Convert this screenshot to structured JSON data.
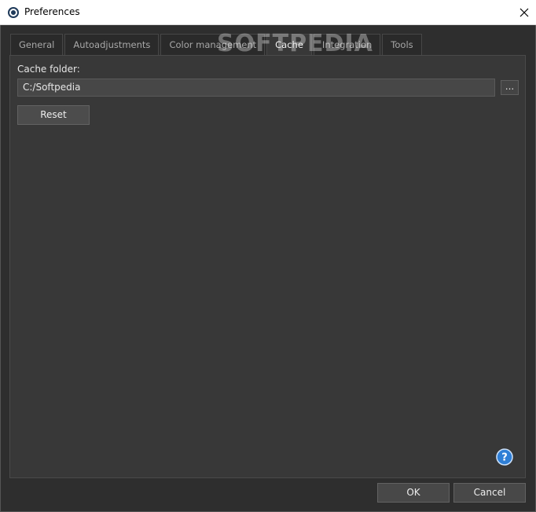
{
  "window": {
    "title": "Preferences"
  },
  "tabs": [
    {
      "label": "General"
    },
    {
      "label": "Autoadjustments"
    },
    {
      "label": "Color management"
    },
    {
      "label": "Cache",
      "active": true
    },
    {
      "label": "Integration"
    },
    {
      "label": "Tools"
    }
  ],
  "cache": {
    "folder_label": "Cache folder:",
    "folder_value": "C:/Softpedia",
    "browse_label": "...",
    "reset_label": "Reset"
  },
  "footer": {
    "ok_label": "OK",
    "cancel_label": "Cancel"
  },
  "watermark": "SOFTPEDIA",
  "colors": {
    "background": "#2e2e2e",
    "panel": "#383838",
    "help_blue": "#2f7fd6"
  },
  "icons": {
    "app": "app-logo-icon",
    "close": "close-icon",
    "help": "help-icon"
  }
}
